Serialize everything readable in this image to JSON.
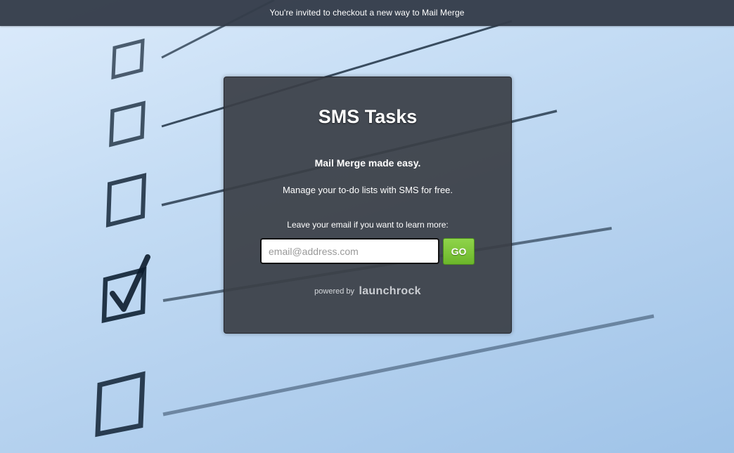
{
  "banner": {
    "text": "You're invited to checkout a new way to Mail Merge"
  },
  "card": {
    "title": "SMS Tasks",
    "tagline": "Mail Merge made easy.",
    "description": "Manage your to-do lists with SMS for free.",
    "prompt": "Leave your email if you want to learn more:",
    "email_placeholder": "email@address.com",
    "email_value": "",
    "go_label": "GO",
    "powered_label": "powered by",
    "powered_brand": "launchrock"
  },
  "background": {
    "checklist_items": 5,
    "checked_item_index": 3
  },
  "colors": {
    "banner_bg": "#343c4a",
    "card_bg": "#3a3e46",
    "go_button": "#7cc63a",
    "background": "#c4dcf4"
  }
}
